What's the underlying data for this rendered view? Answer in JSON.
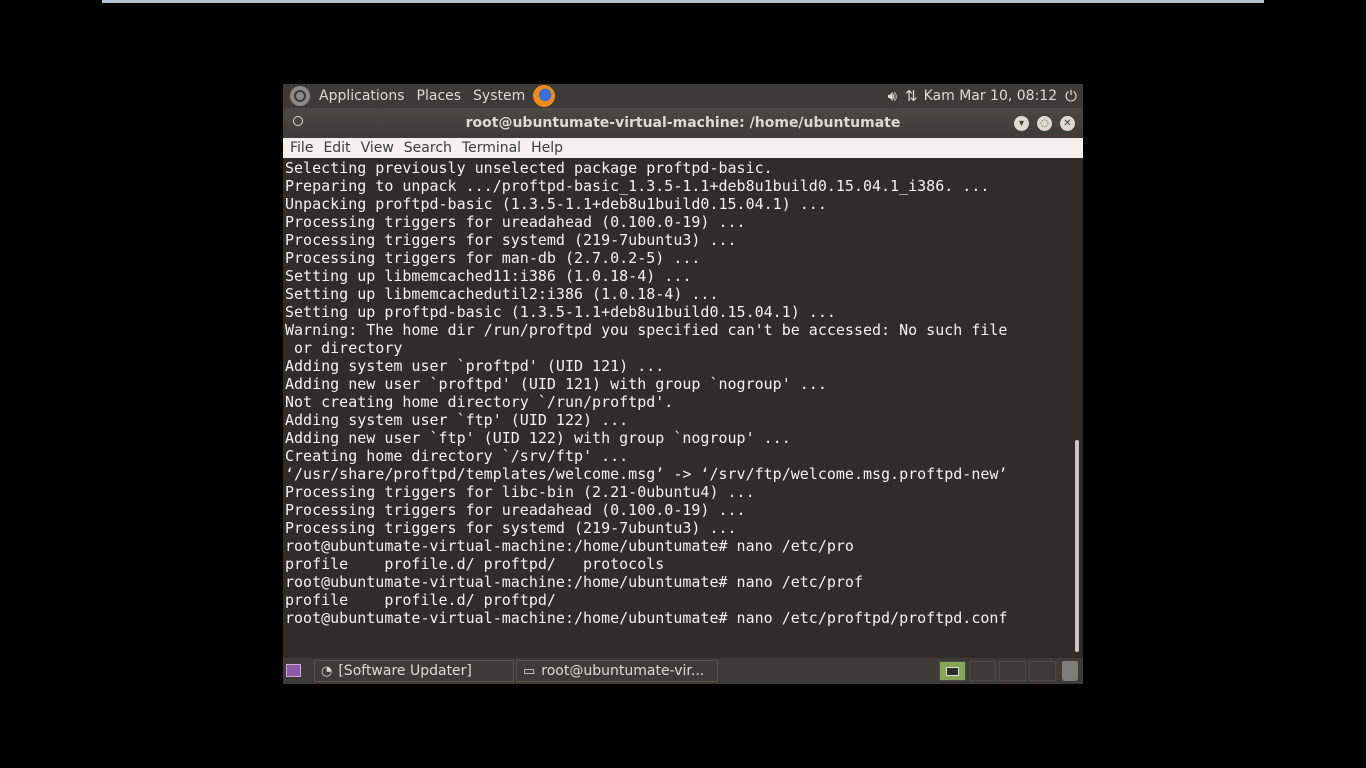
{
  "top_panel": {
    "menus": [
      "Applications",
      "Places",
      "System"
    ],
    "clock": "Kam Mar 10, 08:12"
  },
  "window": {
    "title": "root@ubuntumate-virtual-machine: /home/ubuntumate",
    "menubar": [
      "File",
      "Edit",
      "View",
      "Search",
      "Terminal",
      "Help"
    ]
  },
  "terminal": {
    "lines": [
      "Selecting previously unselected package proftpd-basic.",
      "Preparing to unpack .../proftpd-basic_1.3.5-1.1+deb8u1build0.15.04.1_i386. ...",
      "Unpacking proftpd-basic (1.3.5-1.1+deb8u1build0.15.04.1) ...",
      "Processing triggers for ureadahead (0.100.0-19) ...",
      "Processing triggers for systemd (219-7ubuntu3) ...",
      "Processing triggers for man-db (2.7.0.2-5) ...",
      "Setting up libmemcached11:i386 (1.0.18-4) ...",
      "Setting up libmemcachedutil2:i386 (1.0.18-4) ...",
      "Setting up proftpd-basic (1.3.5-1.1+deb8u1build0.15.04.1) ...",
      "Warning: The home dir /run/proftpd you specified can't be accessed: No such file",
      " or directory",
      "Adding system user `proftpd' (UID 121) ...",
      "Adding new user `proftpd' (UID 121) with group `nogroup' ...",
      "Not creating home directory `/run/proftpd'.",
      "Adding system user `ftp' (UID 122) ...",
      "Adding new user `ftp' (UID 122) with group `nogroup' ...",
      "Creating home directory `/srv/ftp' ...",
      "‘/usr/share/proftpd/templates/welcome.msg’ -> ‘/srv/ftp/welcome.msg.proftpd-new’",
      "Processing triggers for libc-bin (2.21-0ubuntu4) ...",
      "Processing triggers for ureadahead (0.100.0-19) ...",
      "Processing triggers for systemd (219-7ubuntu3) ...",
      "root@ubuntumate-virtual-machine:/home/ubuntumate# nano /etc/pro",
      "profile    profile.d/ proftpd/   protocols",
      "root@ubuntumate-virtual-machine:/home/ubuntumate# nano /etc/prof",
      "profile    profile.d/ proftpd/",
      "root@ubuntumate-virtual-machine:/home/ubuntumate# nano /etc/proftpd/proftpd.conf"
    ]
  },
  "taskbar": {
    "tasks": [
      "[Software Updater]",
      "root@ubuntumate-vir..."
    ]
  }
}
